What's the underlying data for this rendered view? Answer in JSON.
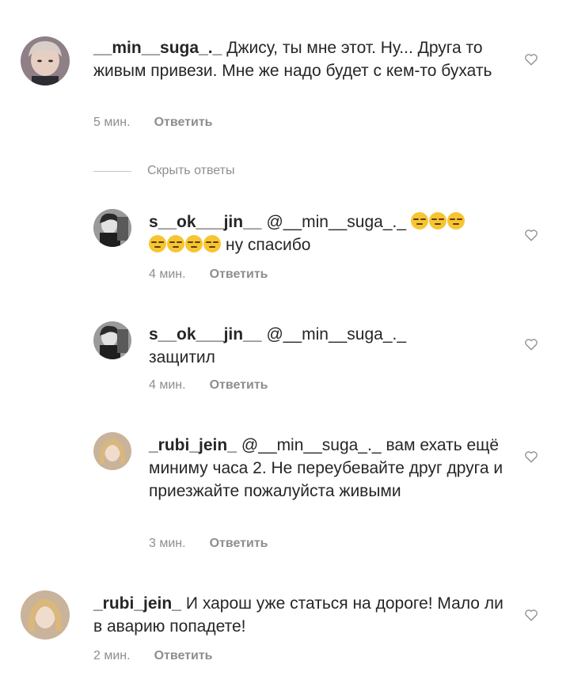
{
  "hide_replies_label": "Скрыть ответы",
  "reply_label": "Ответить",
  "emoji_name": "expressionless-face",
  "comments": [
    {
      "username": "__min__suga_._",
      "mention": "",
      "text": "Джису, ты мне этот. Ну... Друга то живым привези. Мне же надо будет с кем-то бухать",
      "time": "5 мин."
    },
    {
      "username": "s__ok___jin__",
      "mention": "@__min__suga_._",
      "text": "ну спасибо",
      "time": "4 мин."
    },
    {
      "username": "s__ok___jin__",
      "mention": "@__min__suga_._",
      "text": "защитил",
      "time": "4 мин."
    },
    {
      "username": "_rubi_jein_",
      "mention": "@__min__suga_._",
      "text": "вам ехать ещё миниму часа 2. Не переубевайте друг друга и приезжайте пожалуйста живыми",
      "time": "3 мин."
    },
    {
      "username": "_rubi_jein_",
      "mention": "",
      "text": "И харош уже статься на дороге! Мало ли в аварию попадете!",
      "time": "2 мин."
    }
  ]
}
